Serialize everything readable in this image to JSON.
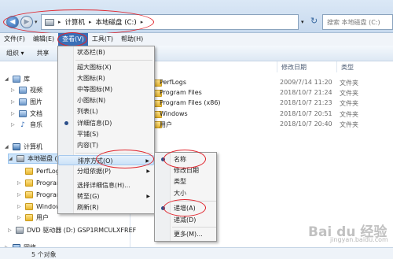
{
  "address": {
    "crumbs": [
      "计算机",
      "本地磁盘 (C:)"
    ],
    "search_placeholder": "搜索 本地磁盘 (C:)"
  },
  "menubar": [
    "文件(F)",
    "编辑(E)",
    "查看(V)",
    "工具(T)",
    "帮助(H)"
  ],
  "toolbar": {
    "organize": "组织 ▾",
    "share": "共享"
  },
  "nav": {
    "library": "库",
    "library_items": [
      "视频",
      "图片",
      "文档",
      "音乐"
    ],
    "computer": "计算机",
    "drive": "本地磁盘 (C:)",
    "drive_children": [
      "PerfLogs",
      "Program",
      "Program",
      "Window",
      "用户"
    ],
    "dvd": "DVD 驱动器 (D:) GSP1RMCULXFREF",
    "network": "网络"
  },
  "columns": {
    "date": "修改日期",
    "type": "类型"
  },
  "files": [
    {
      "name": "PerfLogs",
      "date": "2009/7/14 11:20",
      "type": "文件夹"
    },
    {
      "name": "Program Files",
      "date": "2018/10/7 21:24",
      "type": "文件夹"
    },
    {
      "name": "Program Files (x86)",
      "date": "2018/10/7 21:23",
      "type": "文件夹"
    },
    {
      "name": "Windows",
      "date": "2018/10/7 20:51",
      "type": "文件夹"
    },
    {
      "name": "用户",
      "date": "2018/10/7 20:40",
      "type": "文件夹"
    }
  ],
  "view_menu": {
    "items": [
      "状态栏(B)",
      "超大图标(X)",
      "大图标(R)",
      "中等图标(M)",
      "小图标(N)",
      "列表(L)",
      "详细信息(D)",
      "平铺(S)",
      "内容(T)",
      "排序方式(O)",
      "分组依据(P)",
      "选择详细信息(H)...",
      "转至(G)",
      "刷新(R)"
    ]
  },
  "sort_menu": {
    "items": [
      "名称",
      "修改日期",
      "类型",
      "大小",
      "递增(A)",
      "递减(D)",
      "更多(M)..."
    ]
  },
  "status": "5 个对象",
  "watermark": {
    "brand": "Bai du 经验",
    "url": "jingyan.baidu.com"
  }
}
